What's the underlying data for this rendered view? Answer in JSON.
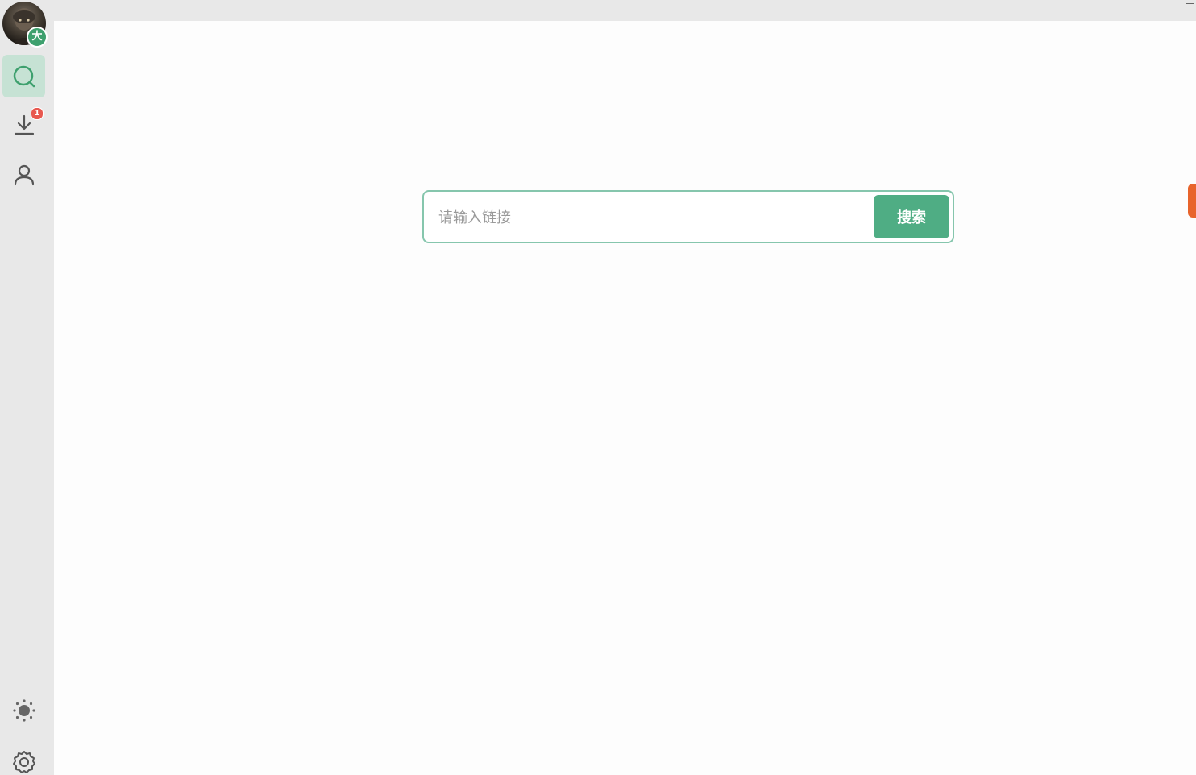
{
  "avatar": {
    "badge_text": "大"
  },
  "sidebar": {
    "items": [
      {
        "name": "search",
        "icon": "search-icon",
        "active": true
      },
      {
        "name": "download",
        "icon": "download-icon",
        "badge": "1"
      },
      {
        "name": "user",
        "icon": "user-icon"
      }
    ],
    "bottom": [
      {
        "name": "theme",
        "icon": "sun-icon"
      },
      {
        "name": "settings",
        "icon": "gear-icon"
      }
    ]
  },
  "search": {
    "placeholder": "请输入链接",
    "value": "",
    "button_label": "搜索"
  },
  "colors": {
    "accent": "#4fad84",
    "active_bg": "#c6e2d4",
    "border": "#86c6ad",
    "badge": "#e8584f",
    "side_tag": "#e8642c"
  }
}
